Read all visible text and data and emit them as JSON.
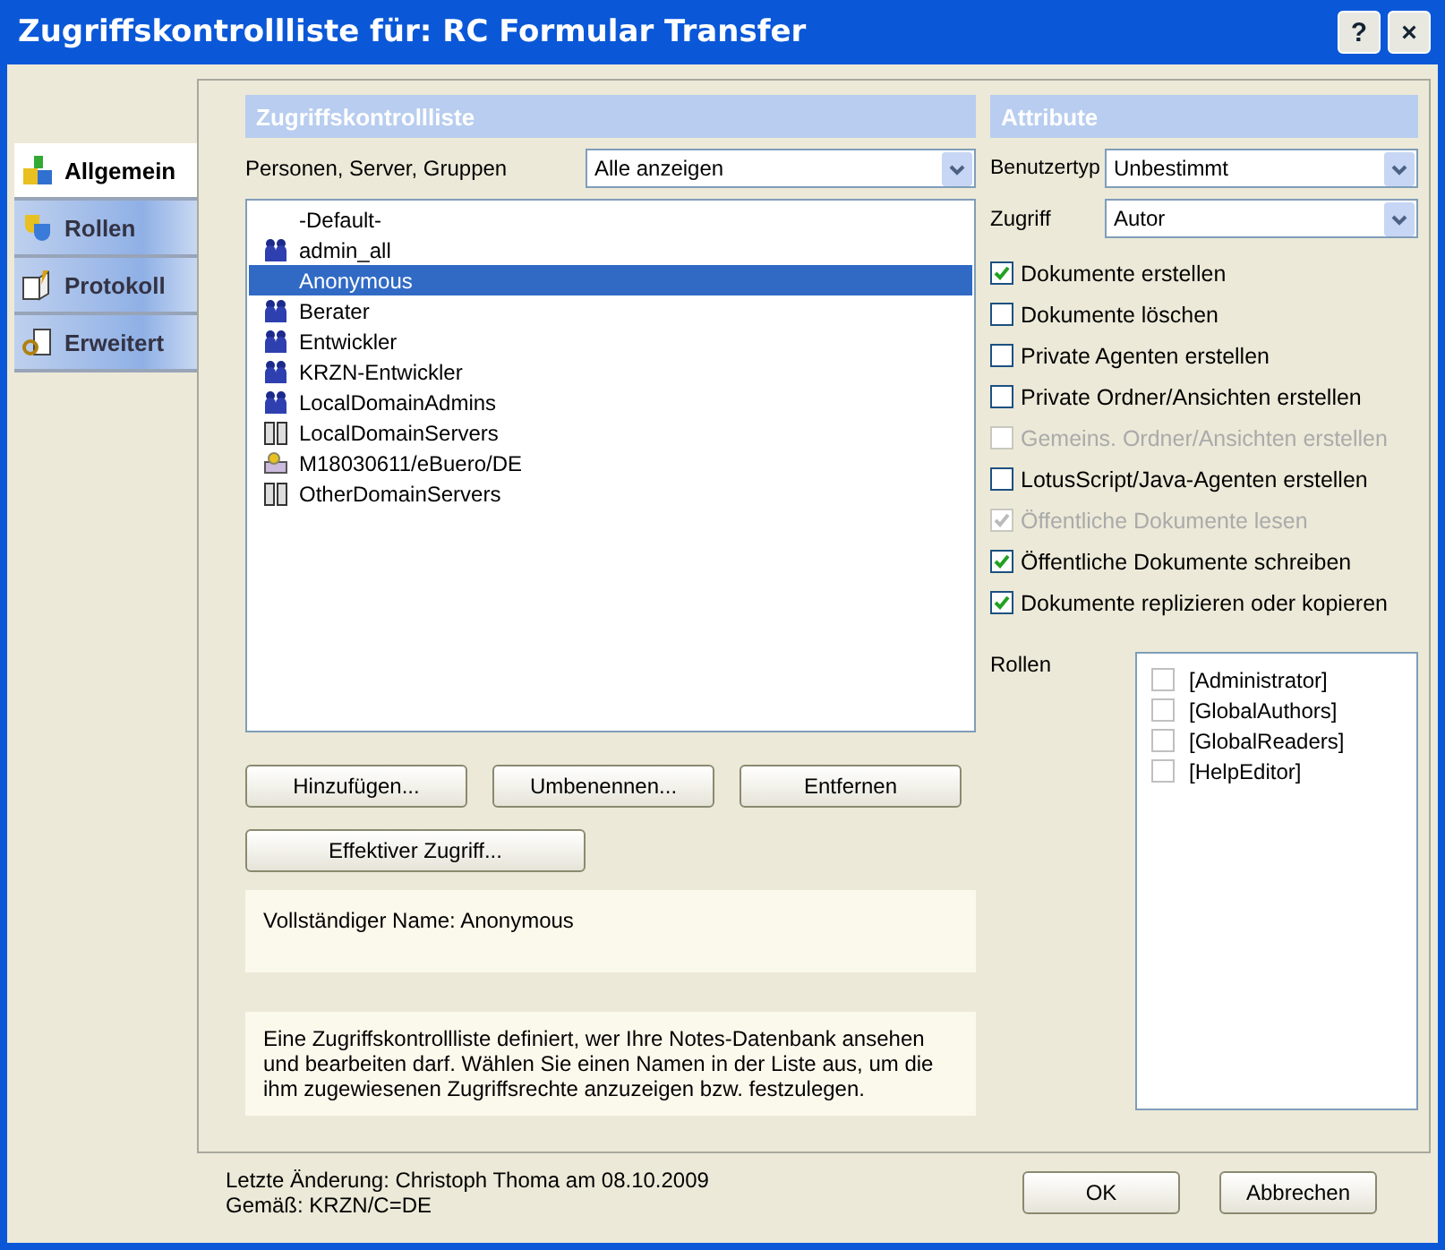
{
  "window": {
    "title": "Zugriffskontrollliste für: RC Formular Transfer",
    "help": "?",
    "close": "×"
  },
  "sidebar": {
    "tabs": [
      {
        "label": "Allgemein",
        "kind": "general",
        "selected": true
      },
      {
        "label": "Rollen",
        "kind": "roles",
        "selected": false
      },
      {
        "label": "Protokoll",
        "kind": "log",
        "selected": false
      },
      {
        "label": "Erweitert",
        "kind": "advanced",
        "selected": false
      }
    ]
  },
  "acl": {
    "header": "Zugriffskontrollliste",
    "filter_label": "Personen, Server, Gruppen",
    "filter_value": "Alle anzeigen",
    "entries": [
      {
        "name": "-Default-",
        "kind": "none",
        "selected": false
      },
      {
        "name": "admin_all",
        "kind": "group",
        "selected": false
      },
      {
        "name": "Anonymous",
        "kind": "none",
        "selected": true
      },
      {
        "name": "Berater",
        "kind": "group",
        "selected": false
      },
      {
        "name": "Entwickler",
        "kind": "group",
        "selected": false
      },
      {
        "name": "KRZN-Entwickler",
        "kind": "group",
        "selected": false
      },
      {
        "name": "LocalDomainAdmins",
        "kind": "group",
        "selected": false
      },
      {
        "name": "LocalDomainServers",
        "kind": "server",
        "selected": false
      },
      {
        "name": "M18030611/eBuero/DE",
        "kind": "person",
        "selected": false
      },
      {
        "name": "OtherDomainServers",
        "kind": "server",
        "selected": false
      }
    ],
    "buttons": [
      "Hinzufügen...",
      "Umbenennen...",
      "Entfernen"
    ],
    "effective_button": "Effektiver Zugriff...",
    "full_name": "Vollständiger Name: Anonymous",
    "description": "Eine Zugriffskontrollliste definiert, wer Ihre Notes-Datenbank ansehen und bearbeiten darf. Wählen Sie einen Namen in der Liste aus, um die ihm zugewiesenen Zugriffsrechte anzuzeigen bzw. festzulegen."
  },
  "attributes": {
    "header": "Attribute",
    "user_type_label": "Benutzertyp",
    "user_type_value": "Unbestimmt",
    "access_label": "Zugriff",
    "access_value": "Autor",
    "options": [
      {
        "label": "Dokumente erstellen",
        "checked": true,
        "disabled": false
      },
      {
        "label": "Dokumente löschen",
        "checked": false,
        "disabled": false
      },
      {
        "label": "Private Agenten erstellen",
        "checked": false,
        "disabled": false
      },
      {
        "label": "Private Ordner/Ansichten erstellen",
        "checked": false,
        "disabled": false
      },
      {
        "label": "Gemeins. Ordner/Ansichten erstellen",
        "checked": false,
        "disabled": true
      },
      {
        "label": "LotusScript/Java-Agenten erstellen",
        "checked": false,
        "disabled": false
      },
      {
        "label": "Öffentliche Dokumente lesen",
        "checked": true,
        "disabled": true
      },
      {
        "label": "Öffentliche Dokumente schreiben",
        "checked": true,
        "disabled": false
      },
      {
        "label": "Dokumente replizieren oder kopieren",
        "checked": true,
        "disabled": false
      }
    ],
    "roles_label": "Rollen",
    "roles": [
      {
        "label": "[Administrator]",
        "checked": false
      },
      {
        "label": "[GlobalAuthors]",
        "checked": false
      },
      {
        "label": "[GlobalReaders]",
        "checked": false
      },
      {
        "label": "[HelpEditor]",
        "checked": false
      }
    ]
  },
  "footer": {
    "last_change": "Letzte Änderung: Christoph Thoma am 08.10.2009",
    "according": "Gemäß: KRZN/C=DE",
    "ok": "OK",
    "cancel": "Abbrechen"
  }
}
